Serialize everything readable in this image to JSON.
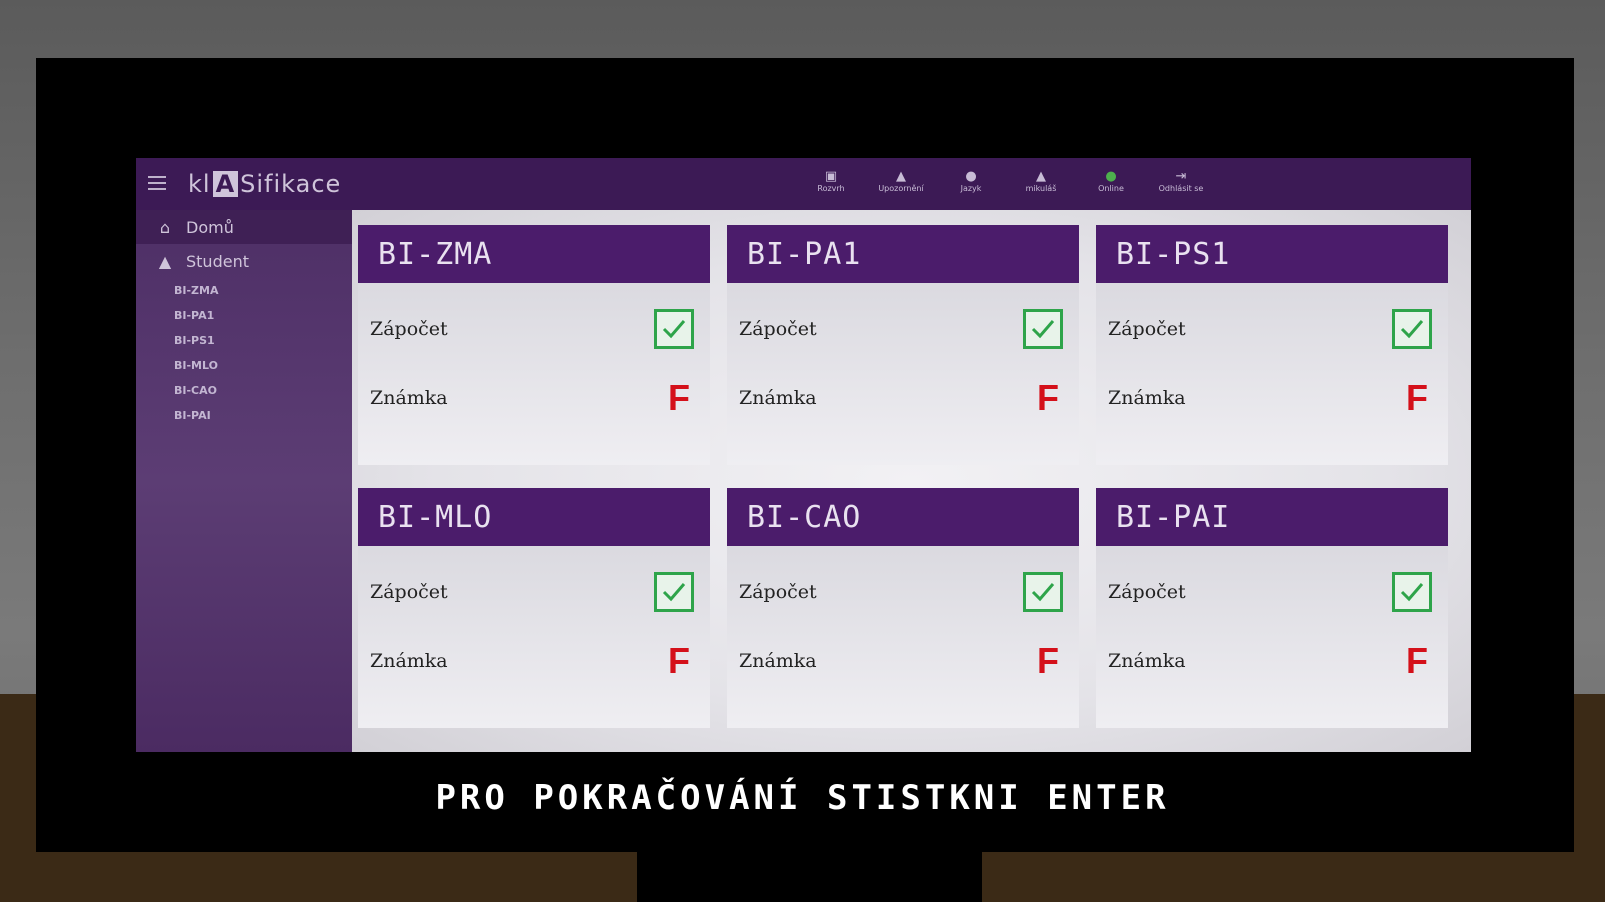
{
  "app": {
    "logo_pre": "kl",
    "logo_box": "A",
    "logo_post": "Sifikace"
  },
  "toolbar": [
    {
      "label": "Rozvrh",
      "icon": "calendar-icon"
    },
    {
      "label": "Upozornění",
      "icon": "bell-icon"
    },
    {
      "label": "Jazyk",
      "icon": "globe-icon"
    },
    {
      "label": "mikuláš",
      "icon": "user-icon"
    },
    {
      "label": "Online",
      "icon": "online-icon"
    },
    {
      "label": "Odhlásit se",
      "icon": "logout-icon"
    }
  ],
  "sidebar": {
    "home": "Domů",
    "student": "Student",
    "courses": [
      "BI-ZMA",
      "BI-PA1",
      "BI-PS1",
      "BI-MLO",
      "BI-CAO",
      "BI-PAI"
    ]
  },
  "cards": [
    {
      "title": "BI-ZMA",
      "credit_label": "Zápočet",
      "credit": true,
      "grade_label": "Známka",
      "grade": "F"
    },
    {
      "title": "BI-PA1",
      "credit_label": "Zápočet",
      "credit": true,
      "grade_label": "Známka",
      "grade": "F"
    },
    {
      "title": "BI-PS1",
      "credit_label": "Zápočet",
      "credit": true,
      "grade_label": "Známka",
      "grade": "F"
    },
    {
      "title": "BI-MLO",
      "credit_label": "Zápočet",
      "credit": true,
      "grade_label": "Známka",
      "grade": "F"
    },
    {
      "title": "BI-CAO",
      "credit_label": "Zápočet",
      "credit": true,
      "grade_label": "Známka",
      "grade": "F"
    },
    {
      "title": "BI-PAI",
      "credit_label": "Zápočet",
      "credit": true,
      "grade_label": "Známka",
      "grade": "F"
    }
  ],
  "prompt": "PRO POKRAČOVÁNÍ STISTKNI ENTER",
  "colors": {
    "header": "#4b1c6b",
    "topbar": "#3c1a55",
    "check": "#2ea44a",
    "grade": "#d4101a"
  }
}
